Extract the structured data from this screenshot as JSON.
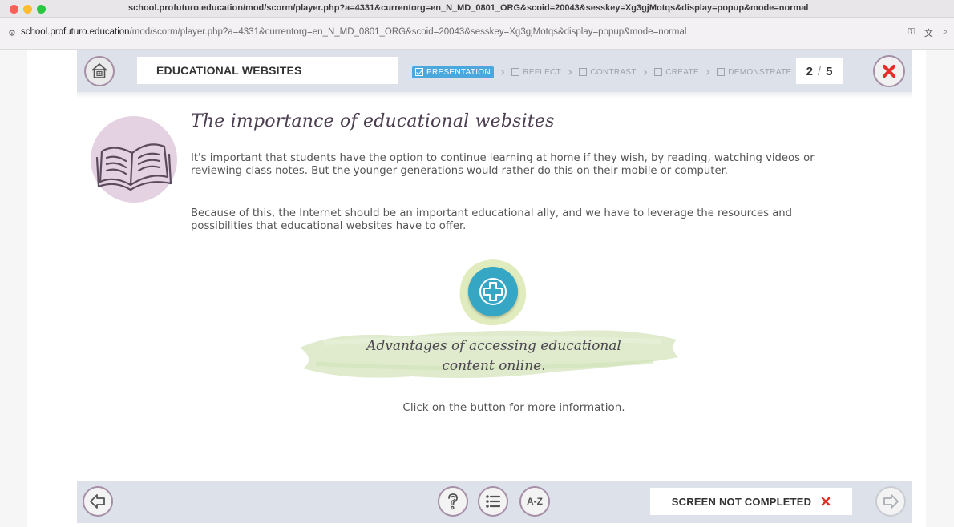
{
  "browser": {
    "window_title": "school.profuturo.education/mod/scorm/player.php?a=4331&currentorg=en_N_MD_0801_ORG&scoid=20043&sesskey=Xg3gjMotqs&display=popup&mode=normal",
    "url_host": "school.profuturo.education",
    "url_path": "/mod/scorm/player.php?a=4331&currentorg=en_N_MD_0801_ORG&scoid=20043&sesskey=Xg3gjMotqs&display=popup&mode=normal"
  },
  "header": {
    "course_title": "EDUCATIONAL WEBSITES",
    "steps": [
      {
        "label": "PRESENTATION",
        "active": true
      },
      {
        "label": "REFLECT",
        "active": false
      },
      {
        "label": "CONTRAST",
        "active": false
      },
      {
        "label": "CREATE",
        "active": false
      },
      {
        "label": "DEMONSTRATE",
        "active": false
      }
    ],
    "page_current": "2",
    "page_separator": "/",
    "page_total": "5"
  },
  "content": {
    "heading": "The importance of educational websites",
    "paragraph1": "It's important that students have the option to continue learning at home if they wish, by reading, watching videos or reviewing class notes. But the younger generations would rather do this on their mobile or computer.",
    "paragraph2": "Because of this, the Internet should be an important educational ally, and we have to leverage the resources and possibilities that educational websites have to offer.",
    "advantages_line1": "Advantages of accessing educational",
    "advantages_line2": "content online.",
    "click_info": "Click on the button for more information."
  },
  "footer": {
    "glossary_label": "A-Z",
    "status_label": "SCREEN NOT COMPLETED"
  },
  "colors": {
    "accent_blue": "#4aa8dd",
    "plus_button": "#35a6c4",
    "bar_background": "#dde2ea",
    "circle_border": "#a58ea6",
    "book_circle": "#e4d2e3",
    "close_red": "#e0312a",
    "brush_green": "#dbe9c7"
  }
}
